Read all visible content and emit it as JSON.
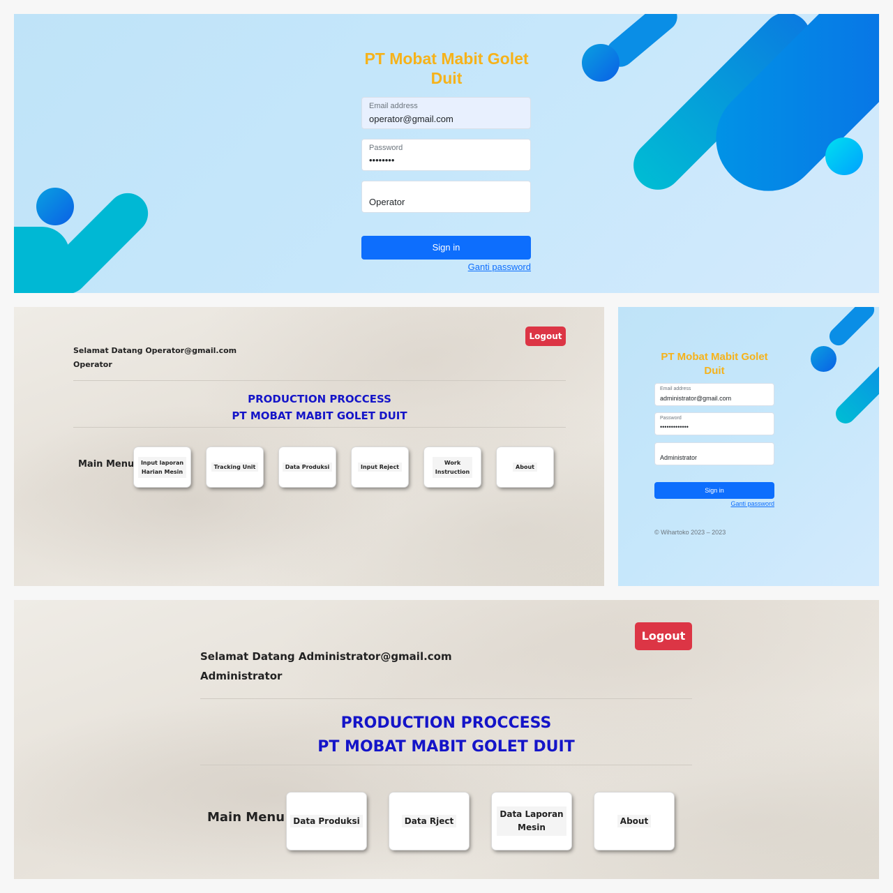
{
  "operator_login": {
    "brand_line1": "PT Mobat Mabit Golet",
    "brand_line2": "Duit",
    "email_label": "Email address",
    "email_value": "operator@gmail.com",
    "password_label": "Password",
    "password_value": "••••••••",
    "role_value": "Operator",
    "signin_label": "Sign in",
    "ganti_password": "Ganti password"
  },
  "operator_dashboard": {
    "logout_label": "Logout",
    "welcome_line": "Selamat Datang Operator@gmail.com",
    "role_line": "Operator",
    "title_line1": "PRODUCTION PROCCESS",
    "title_line2": "PT MOBAT MABIT GOLET DUIT",
    "menu_label": "Main Menu",
    "menu": [
      {
        "line1": "Input laporan",
        "line2": "Harian Mesin"
      },
      {
        "line1": "Tracking Unit",
        "line2": ""
      },
      {
        "line1": "Data Produksi",
        "line2": ""
      },
      {
        "line1": "Input Reject",
        "line2": ""
      },
      {
        "line1": "Work",
        "line2": "Instruction"
      },
      {
        "line1": "About",
        "line2": ""
      }
    ]
  },
  "admin_login": {
    "brand_line1": "PT Mobat Mabit Golet",
    "brand_line2": "Duit",
    "email_label": "Email address",
    "email_value": "administrator@gmail.com",
    "password_label": "Password",
    "password_value": "•••••••••••••",
    "role_value": "Administrator",
    "signin_label": "Sign in",
    "ganti_password": "Ganti password",
    "footer": "© Wihartoko 2023 – 2023"
  },
  "admin_dashboard": {
    "logout_label": "Logout",
    "welcome_line": "Selamat Datang Administrator@gmail.com",
    "role_line": "Administrator",
    "title_line1": "PRODUCTION PROCCESS",
    "title_line2": "PT MOBAT MABIT GOLET DUIT",
    "menu_label": "Main Menu",
    "menu": [
      {
        "line1": "Data Produksi",
        "line2": ""
      },
      {
        "line1": "Data Rject",
        "line2": ""
      },
      {
        "line1": "Data Laporan",
        "line2": "Mesin"
      },
      {
        "line1": "About",
        "line2": ""
      }
    ]
  },
  "colors": {
    "brand": "#f6b21a",
    "primary": "#0d6efd",
    "danger": "#dc3545",
    "title_blue": "#1414c8"
  }
}
